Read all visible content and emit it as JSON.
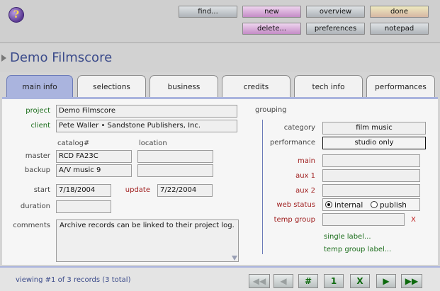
{
  "toolbar": {
    "help_label": "?",
    "find": "find...",
    "new": "new",
    "overview": "overview",
    "done": "done",
    "delete": "delete...",
    "preferences": "preferences",
    "notepad": "notepad"
  },
  "title": "Demo Filmscore",
  "tabs": [
    "main info",
    "selections",
    "business",
    "credits",
    "tech info",
    "performances"
  ],
  "main": {
    "project_label": "project",
    "project_value": "Demo Filmscore",
    "client_label": "client",
    "client_value": "Pete Waller • Sandstone Publishers, Inc.",
    "catalog_header": "catalog#",
    "location_header": "location",
    "master_label": "master",
    "master_catalog": "RCD FA23C",
    "master_location": "",
    "backup_label": "backup",
    "backup_catalog": "A/V music 9",
    "backup_location": "",
    "start_label": "start",
    "start_value": "7/18/2004",
    "update_label": "update",
    "update_value": "7/22/2004",
    "duration_label": "duration",
    "duration_value": "",
    "comments_label": "comments",
    "comments_value": "Archive records can be linked to their project log."
  },
  "grouping": {
    "header": "grouping",
    "category_label": "category",
    "category_value": "film music",
    "performance_label": "performance",
    "performance_value": "studio only",
    "main_label": "main",
    "main_value": "",
    "aux1_label": "aux 1",
    "aux1_value": "",
    "aux2_label": "aux 2",
    "aux2_value": "",
    "web_status_label": "web status",
    "web_options": [
      "internal",
      "publish"
    ],
    "web_selected": "internal",
    "temp_group_label": "temp group",
    "temp_group_value": "",
    "clear_mark": "X",
    "single_label_link": "single label...",
    "temp_group_label_link": "temp group label..."
  },
  "footer": {
    "status": "viewing #1 of 3 records (3 total)",
    "nav": {
      "first": "◀◀",
      "prev": "◀",
      "hash": "#",
      "one": "1",
      "x": "X",
      "next": "▶",
      "last": "▶▶"
    }
  },
  "colors": {
    "accent_tab": "#aab4de",
    "title_text": "#3a4a8a",
    "label_green": "#1b6d1b",
    "label_red": "#a02020"
  }
}
